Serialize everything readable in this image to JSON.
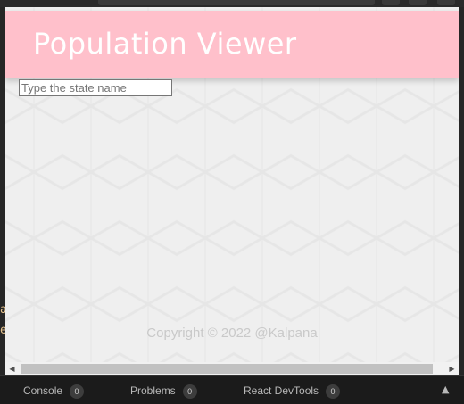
{
  "app": {
    "title": "Population Viewer",
    "search_placeholder": "Type the state name",
    "search_value": "",
    "copyright": "Copyright © 2022 @Kalpana"
  },
  "editor_gutter": {
    "chars": [
      "a",
      "e"
    ]
  },
  "devtools": {
    "tabs": [
      {
        "label": "Console",
        "count": "0"
      },
      {
        "label": "Problems",
        "count": "0"
      },
      {
        "label": "React DevTools",
        "count": "0"
      }
    ],
    "expand_icon": "chevron-up-icon"
  },
  "colors": {
    "header_bg": "#ffc0cb",
    "header_text": "#ffffff",
    "page_bg": "#efefef",
    "devtools_bg": "#1b1b1b"
  }
}
